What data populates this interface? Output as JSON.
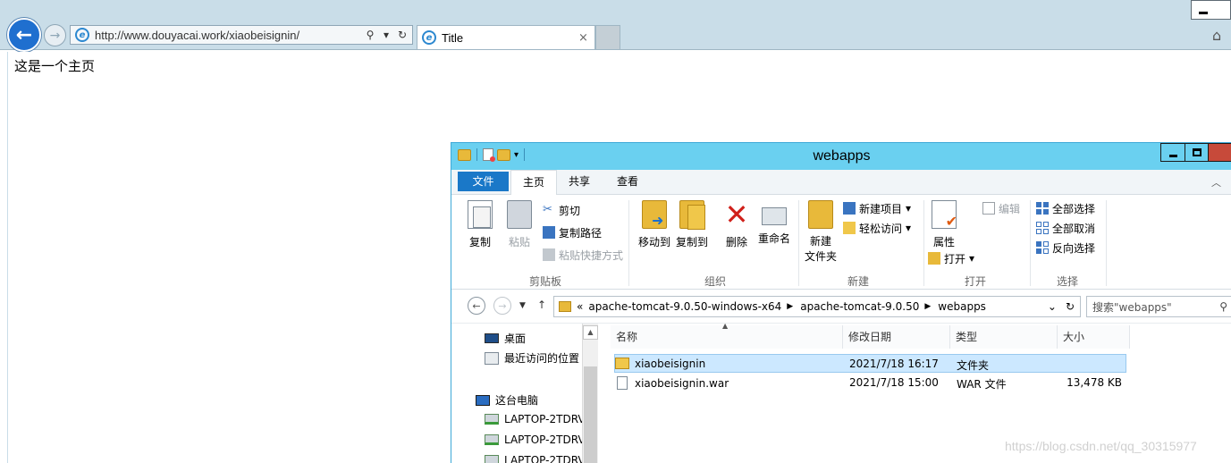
{
  "browser": {
    "url": "http://www.douyacai.work/xiaobeisignin/",
    "tab_title": "Title",
    "tab_close": "×",
    "colors": {
      "toolbar": "#c9dde8",
      "back_button": "#1f6fcf"
    }
  },
  "page": {
    "heading": "这是一个主页"
  },
  "explorer": {
    "title": "webapps",
    "ribbon_tabs": {
      "file": "文件",
      "home": "主页",
      "share": "共享",
      "view": "查看"
    },
    "clipboard": {
      "copy": "复制",
      "paste": "粘贴",
      "cut": "剪切",
      "copy_path": "复制路径",
      "paste_shortcut": "粘贴快捷方式",
      "group": "剪贴板"
    },
    "organize": {
      "move_to": "移动到",
      "copy_to": "复制到",
      "delete": "删除",
      "rename": "重命名",
      "group": "组织"
    },
    "new": {
      "new_folder": "新建\n文件夹",
      "new_folder_line1": "新建",
      "new_folder_line2": "文件夹",
      "new_item": "新建项目",
      "easy_access": "轻松访问",
      "group": "新建"
    },
    "open": {
      "properties": "属性",
      "open": "打开",
      "edit": "编辑",
      "group": "打开"
    },
    "select": {
      "select_all": "全部选择",
      "select_none": "全部取消",
      "invert": "反向选择",
      "group": "选择"
    },
    "address": {
      "crumbs": [
        "apache-tomcat-9.0.50-windows-x64",
        "apache-tomcat-9.0.50",
        "webapps"
      ],
      "overflow": "«",
      "search_placeholder": "搜索\"webapps\""
    },
    "nav_pane": {
      "desktop": "桌面",
      "recent": "最近访问的位置",
      "this_pc": "这台电脑",
      "network_items": [
        "LAPTOP-2TDRV",
        "LAPTOP-2TDRV",
        "LAPTOP-2TDRV"
      ]
    },
    "columns": {
      "name": "名称",
      "modified": "修改日期",
      "type": "类型",
      "size": "大小"
    },
    "files": [
      {
        "name": "xiaobeisignin",
        "modified": "2021/7/18 16:17",
        "type": "文件夹",
        "size": "",
        "icon": "folder-icon",
        "selected": true
      },
      {
        "name": "xiaobeisignin.war",
        "modified": "2021/7/18 15:00",
        "type": "WAR 文件",
        "size": "13,478 KB",
        "icon": "file-icon",
        "selected": false
      }
    ],
    "colors": {
      "titlebar": "#6ad0f0",
      "file_tab": "#1a78c8",
      "selection": "#cce8ff",
      "close_button": "#c74a3a"
    }
  },
  "watermark": "https://blog.csdn.net/qq_30315977"
}
